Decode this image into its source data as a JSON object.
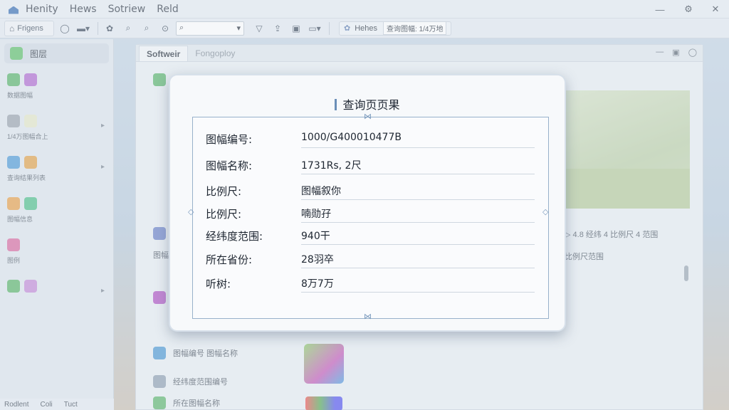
{
  "titlebar": {
    "menus": [
      "Henity",
      "Hews",
      "Sotriew",
      "Reld"
    ],
    "controls": [
      "—",
      "⚙",
      "✕"
    ]
  },
  "toolbar": {
    "home_label": "Frigens",
    "search_placeholder": "",
    "status_label": "Hehes",
    "status_text": "查询图幅: 1/4万地"
  },
  "sidebar": {
    "header": "图层",
    "items": [
      {
        "label": "数据图幅"
      },
      {
        "label": "1/4万图幅合上"
      },
      {
        "label": "查询结果列表"
      },
      {
        "label": "图幅信息"
      },
      {
        "label": "图例"
      }
    ],
    "bottom_tabs": [
      "Rodlent",
      "Coli",
      "Tuct"
    ]
  },
  "main": {
    "tabs": [
      "Softweir",
      "Fongoploy"
    ],
    "bg_rows": [
      "图幅",
      "图幅",
      "",
      "",
      "",
      "",
      "",
      "图幅编号 图幅名称",
      "经纬度范围编号",
      "所在图幅名称"
    ],
    "bg_status": "▷ 4.8 经纬 4 比例尺 4 范围",
    "bg_status2": "比例尺范围"
  },
  "dialog": {
    "title": "查询页页果",
    "rows": [
      {
        "key": "图幅编号:",
        "value": "1000/G400010477B"
      },
      {
        "key": "图幅名称:",
        "value": "1731Rs, 2尺"
      },
      {
        "key": "比例尺:",
        "value": "图幅叙你"
      },
      {
        "key": "比例尺:",
        "value": "喃勋孖"
      },
      {
        "key": "经纬度范围:",
        "value": "940干"
      },
      {
        "key": "所在省份:",
        "value": "28羽卒"
      },
      {
        "key": "听树:",
        "value": "8万7万"
      }
    ]
  },
  "colors": {
    "dialog_border": "#98b1cb",
    "accent": "#6b8fb8"
  }
}
